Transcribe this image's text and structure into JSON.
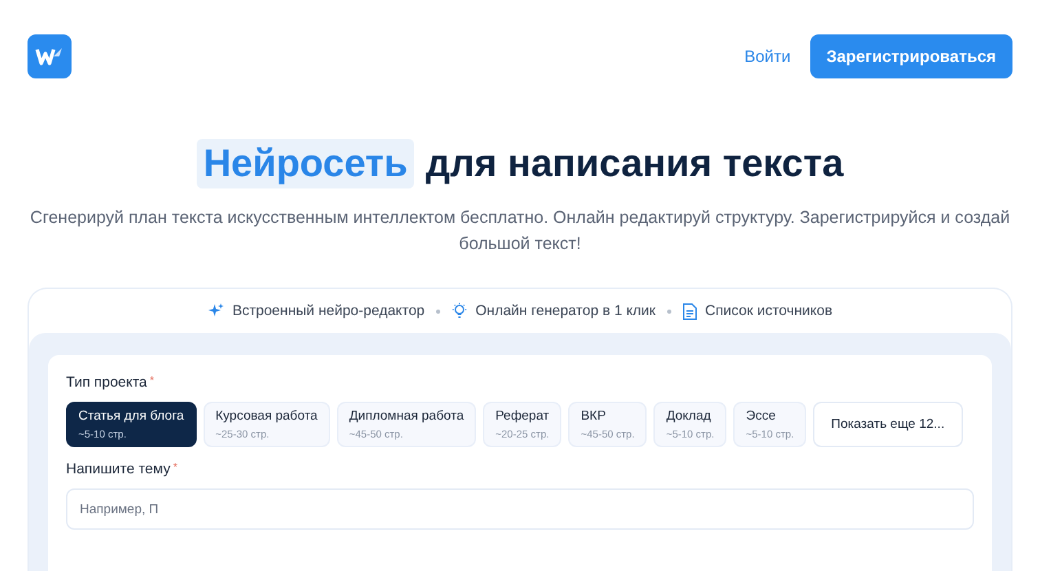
{
  "header": {
    "login": "Войти",
    "register": "Зарегистрироваться"
  },
  "hero": {
    "title_highlight": "Нейросеть",
    "title_rest": "для написания текста",
    "subtitle": "Сгенерируй план текста искусственным интеллектом бесплатно. Онлайн редактируй структуру. Зарегистрируйся и создай большой текст!"
  },
  "features": [
    {
      "kind": "sparkle",
      "label": "Встроенный нейро-редактор"
    },
    {
      "kind": "bulb",
      "label": "Онлайн генератор в 1 клик"
    },
    {
      "kind": "doc",
      "label": "Список источников"
    }
  ],
  "form": {
    "project_type_label": "Тип проекта",
    "required_mark": "*",
    "project_types": [
      {
        "name": "Статья для блога",
        "pages": "~5-10 стр.",
        "selected": true
      },
      {
        "name": "Курсовая работа",
        "pages": "~25-30 стр.",
        "selected": false
      },
      {
        "name": "Дипломная работа",
        "pages": "~45-50 стр.",
        "selected": false
      },
      {
        "name": "Реферат",
        "pages": "~20-25 стр.",
        "selected": false
      },
      {
        "name": "ВКР",
        "pages": "~45-50 стр.",
        "selected": false
      },
      {
        "name": "Доклад",
        "pages": "~5-10 стр.",
        "selected": false
      },
      {
        "name": "Эссе",
        "pages": "~5-10 стр.",
        "selected": false
      }
    ],
    "show_more": "Показать еще 12...",
    "topic_label": "Напишите тему",
    "topic_required_mark": "*",
    "topic_placeholder": "Например, П"
  }
}
